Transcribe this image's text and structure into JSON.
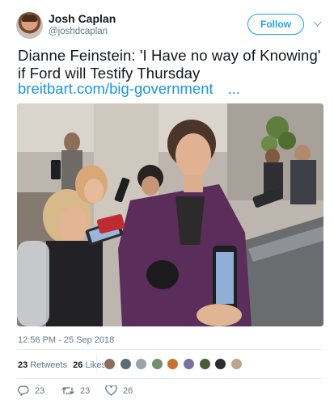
{
  "author": {
    "name": "Josh Caplan",
    "handle": "@joshdcaplan"
  },
  "follow_label": "Follow",
  "tweet": {
    "text": "Dianne Feinstein: 'I Have no way of Knowing' if Ford will Testify Thursday",
    "link": "breitbart.com/big-government",
    "link_ellipsis": "..."
  },
  "timestamp": "12:56 PM - 25 Sep 2018",
  "stats": {
    "retweets_count": "23",
    "retweets_label": "Retweets",
    "likes_count": "26",
    "likes_label": "Likes"
  },
  "likers": [
    {
      "icon": "liker-avatar",
      "color": "#8a6f5c"
    },
    {
      "icon": "liker-avatar",
      "color": "#5d6a74"
    },
    {
      "icon": "liker-avatar",
      "color": "#9aa3a8"
    },
    {
      "icon": "liker-avatar",
      "color": "#6f8f6a"
    },
    {
      "icon": "liker-avatar",
      "color": "#c4722e"
    },
    {
      "icon": "liker-avatar",
      "color": "#7a6fa0"
    },
    {
      "icon": "liker-avatar",
      "color": "#4d5b3a"
    },
    {
      "icon": "liker-avatar",
      "color": "#2b2b2b"
    },
    {
      "icon": "liker-avatar",
      "color": "#b9a58a"
    }
  ],
  "actions": {
    "reply_count": "23",
    "retweet_count": "23",
    "like_count": "26"
  },
  "colors": {
    "accent": "#1da1f2",
    "link": "#1b95e0",
    "muted": "#657786",
    "coat": "#5b2d5a"
  }
}
